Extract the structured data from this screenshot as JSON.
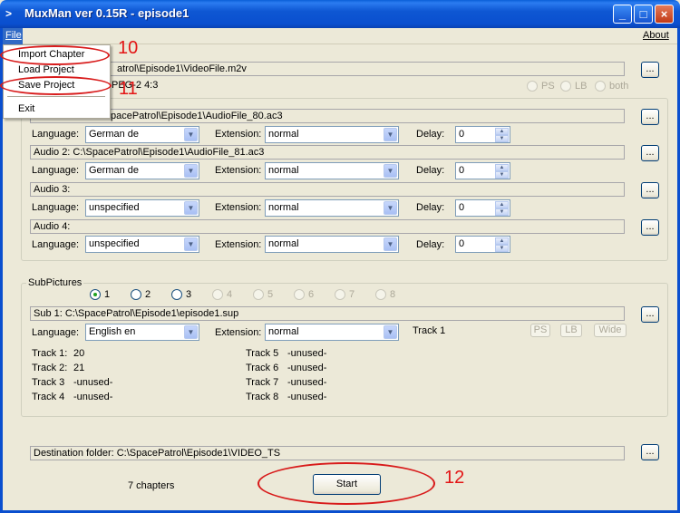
{
  "window": {
    "title": "MuxMan ver 0.15R - episode1",
    "icon": "mux-icon",
    "controls": [
      "minimize-icon",
      "maximize-icon",
      "close-icon"
    ]
  },
  "menubar": {
    "file": "File",
    "about": "About"
  },
  "file_menu": {
    "items": [
      "Import Chapter",
      "Load Project",
      "Save Project",
      "Exit"
    ]
  },
  "video": {
    "path": "C:\\SpacePatrol\\Episode1\\VideoFile.m2v",
    "path_visible": "atrol\\Episode1\\VideoFile.m2v",
    "info_visible": "PEG-2  4:3",
    "display_options": [
      "PS",
      "LB",
      "both"
    ],
    "browse": "..."
  },
  "audio": {
    "tracks": [
      {
        "path_visible": "pacePatrol\\Episode1\\AudioFile_80.ac3",
        "language": "German de",
        "extension": "normal",
        "delay": "0"
      },
      {
        "path_visible": "Audio 2: C:\\SpacePatrol\\Episode1\\AudioFile_81.ac3",
        "language": "German de",
        "extension": "normal",
        "delay": "0"
      },
      {
        "path_visible": "Audio 3:",
        "language": "unspecified",
        "extension": "normal",
        "delay": "0"
      },
      {
        "path_visible": "Audio 4:",
        "language": "unspecified",
        "extension": "normal",
        "delay": "0"
      }
    ],
    "language_label": "Language:",
    "extension_label": "Extension:",
    "delay_label": "Delay:"
  },
  "subpictures": {
    "group_label": "SubPictures",
    "radios": [
      "1",
      "2",
      "3",
      "4",
      "5",
      "6",
      "7",
      "8"
    ],
    "selected": "1",
    "sub1_path": "Sub 1: C:\\SpacePatrol\\Episode1\\episode1.sup",
    "language": "English en",
    "extension": "normal",
    "track_label": "Track 1",
    "buttons": [
      "PS",
      "LB",
      "Wide"
    ],
    "tracks_left": [
      {
        "label": "Track 1:",
        "value": "20"
      },
      {
        "label": "Track 2:",
        "value": "21"
      },
      {
        "label": "Track 3",
        "value": "-unused-"
      },
      {
        "label": "Track 4",
        "value": "-unused-"
      }
    ],
    "tracks_right": [
      {
        "label": "Track 5",
        "value": "-unused-"
      },
      {
        "label": "Track 6",
        "value": "-unused-"
      },
      {
        "label": "Track 7",
        "value": "-unused-"
      },
      {
        "label": "Track 8",
        "value": "-unused-"
      }
    ]
  },
  "destination": {
    "text": "Destination folder: C:\\SpacePatrol\\Episode1\\VIDEO_TS"
  },
  "footer": {
    "chapters": "7 chapters",
    "start": "Start"
  },
  "annotations": {
    "a10": "10",
    "a11": "11",
    "a12": "12",
    "color": "#e31515"
  }
}
